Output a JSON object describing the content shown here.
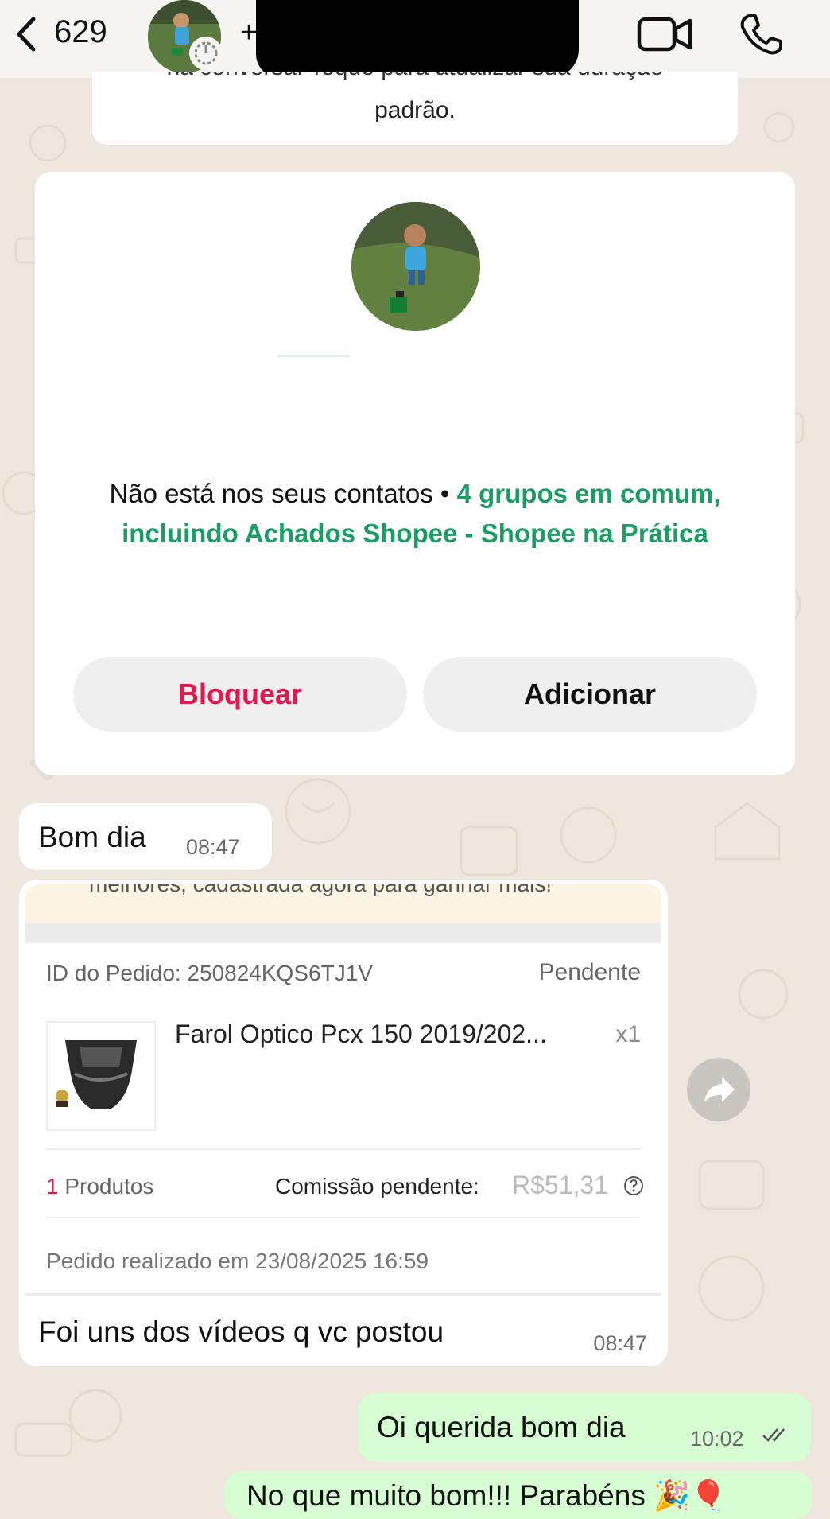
{
  "header": {
    "unread_count": "629",
    "contact_prefix": "+",
    "icons": [
      "back-icon",
      "video-call-icon",
      "voice-call-icon",
      "disappearing-timer-icon"
    ]
  },
  "system_message": {
    "line1": "na conversa. Toque para atualizar sua duração",
    "line2": "padrão."
  },
  "contact_card": {
    "text_plain": "Não está nos seus contatos • ",
    "text_green": "4 grupos em comum, incluindo Achados Shopee - Shopee na Prática",
    "block_label": "Bloquear",
    "add_label": "Adicionar"
  },
  "messages": {
    "m1": {
      "text": "Bom dia",
      "time": "08:47"
    },
    "order": {
      "banner_text": "melhores, cadastrada agora para ganhar mais!",
      "order_id": "ID do Pedido: 250824KQS6TJ1V",
      "status": "Pendente",
      "product_name": "Farol Optico Pcx 150 2019/202...",
      "qty": "x1",
      "products_count": "1",
      "products_label": " Produtos",
      "commission_label": "Comissão pendente:",
      "commission_value": "R$51,31",
      "order_date": "Pedido realizado em 23/08/2025 16:59",
      "caption": "Foi uns dos vídeos q vc postou",
      "time": "08:47"
    },
    "out1": {
      "text": "Oi querida bom dia",
      "time": "10:02"
    },
    "out2": {
      "text": "No que muito bom!!! Parabéns 🎉🎈"
    }
  },
  "colors": {
    "accent_green": "#1a9e63",
    "block_red": "#e6174f",
    "outgoing_bubble": "#d7fdd3",
    "wallpaper": "#efe7de"
  }
}
